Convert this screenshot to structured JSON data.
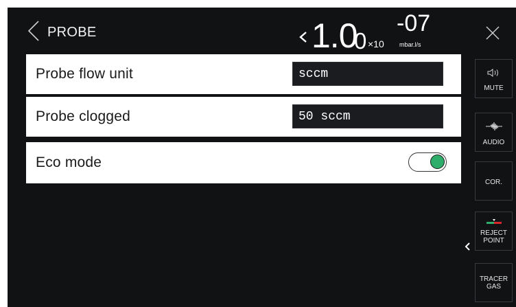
{
  "header": {
    "title": "PROBE",
    "leak_rate": {
      "mantissa": "1.0",
      "trailing_digit": "0",
      "multiplier": "×10",
      "exponent": "-07",
      "unit": "mbar.l/s"
    }
  },
  "settings": [
    {
      "label": "Probe flow unit",
      "value": "sccm"
    },
    {
      "label": "Probe clogged",
      "value": "50 sccm"
    },
    {
      "label": "Eco mode",
      "toggle_on": true
    }
  ],
  "rail": {
    "mute_label": "MUTE",
    "audio_label": "AUDIO",
    "cor_label": "COR.",
    "reject_label_1": "REJECT",
    "reject_label_2": "POINT",
    "tracer_label_1": "TRACER",
    "tracer_label_2": "GAS"
  },
  "icons": {
    "back": "chevron-left-icon",
    "close": "close-icon",
    "mute": "speaker-icon",
    "audio": "waveform-icon",
    "reject": "reject-marker-icon",
    "collapse": "chevron-left-icon"
  },
  "colors": {
    "background": "#111214",
    "row": "#ffffff",
    "value_box": "#1b1c20",
    "toggle_on": "#2fae6b",
    "reject_red": "#d7262c",
    "reject_green": "#2fae6b"
  }
}
